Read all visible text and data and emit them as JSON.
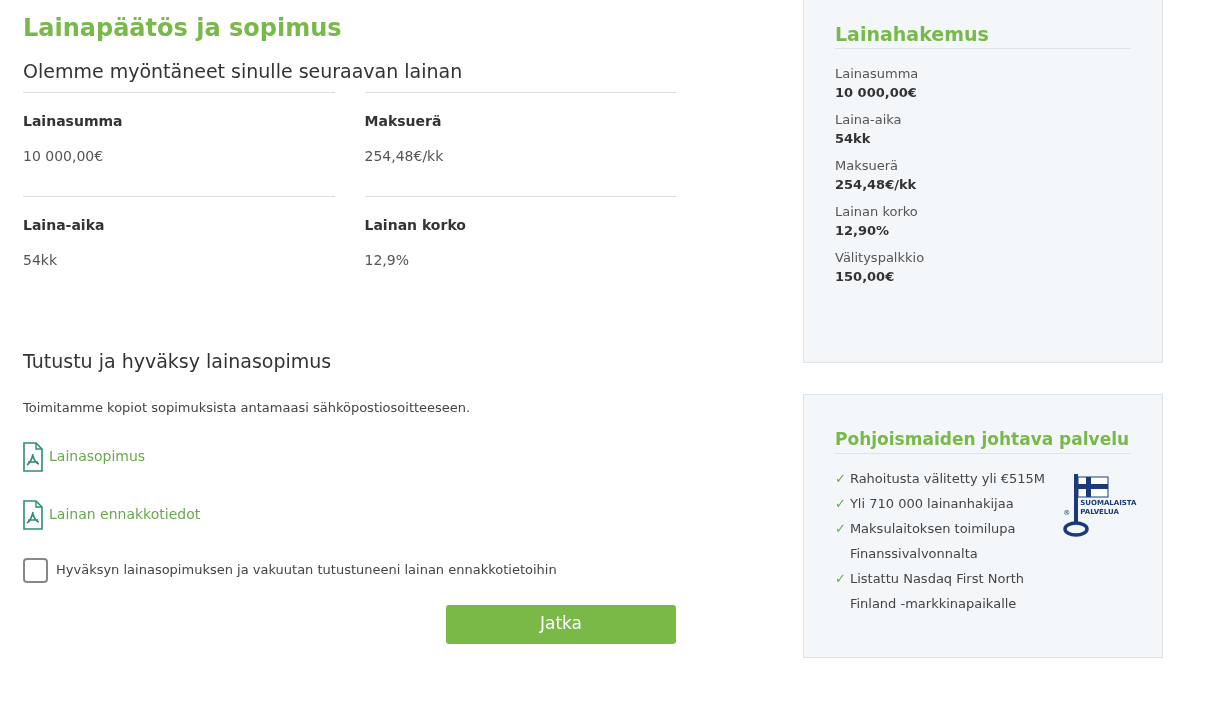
{
  "title": "Lainapäätös ja sopimus",
  "offer": {
    "heading": "Olemme myöntäneet sinulle seuraavan lainan",
    "fields": [
      {
        "label": "Lainasumma",
        "value": "10 000,00€"
      },
      {
        "label": "Maksuerä",
        "value": "254,48€/kk"
      },
      {
        "label": "Laina-aika",
        "value": "54kk"
      },
      {
        "label": "Lainan korko",
        "value": "12,9%"
      }
    ]
  },
  "agreement": {
    "heading": "Tutustu ja hyväksy lainasopimus",
    "note": "Toimitamme kopiot sopimuksista antamaasi sähköpostiosoitteeseen.",
    "documents": [
      "Lainasopimus",
      "Lainan ennakkotiedot"
    ],
    "consent": {
      "label": "Hyväksyn lainasopimuksen ja vakuutan tutustuneeni lainan ennakkotietoihin",
      "checked": false
    },
    "button": "Jatka"
  },
  "summary": {
    "title": "Lainahakemus",
    "items": [
      {
        "label": "Lainasumma",
        "value": "10 000,00€"
      },
      {
        "label": "Laina-aika",
        "value": "54kk"
      },
      {
        "label": "Maksuerä",
        "value": "254,48€/kk"
      },
      {
        "label": "Lainan korko",
        "value": "12,90%"
      },
      {
        "label": "Välityspalkkio",
        "value": "150,00€"
      }
    ]
  },
  "service": {
    "title": "Pohjoismaiden johtava palvelu",
    "check": "✓",
    "points": [
      "Rahoitusta välitetty yli €515M",
      "Yli 710 000 lainanhakijaa",
      "Maksulaitoksen toimilupa Finanssivalvonnalta",
      "Listattu Nasdaq First North Finland -markkinapaikalle"
    ],
    "badge": {
      "lines": [
        "SUOMALAISTA",
        "PALVELUA"
      ],
      "mark": "®"
    }
  }
}
